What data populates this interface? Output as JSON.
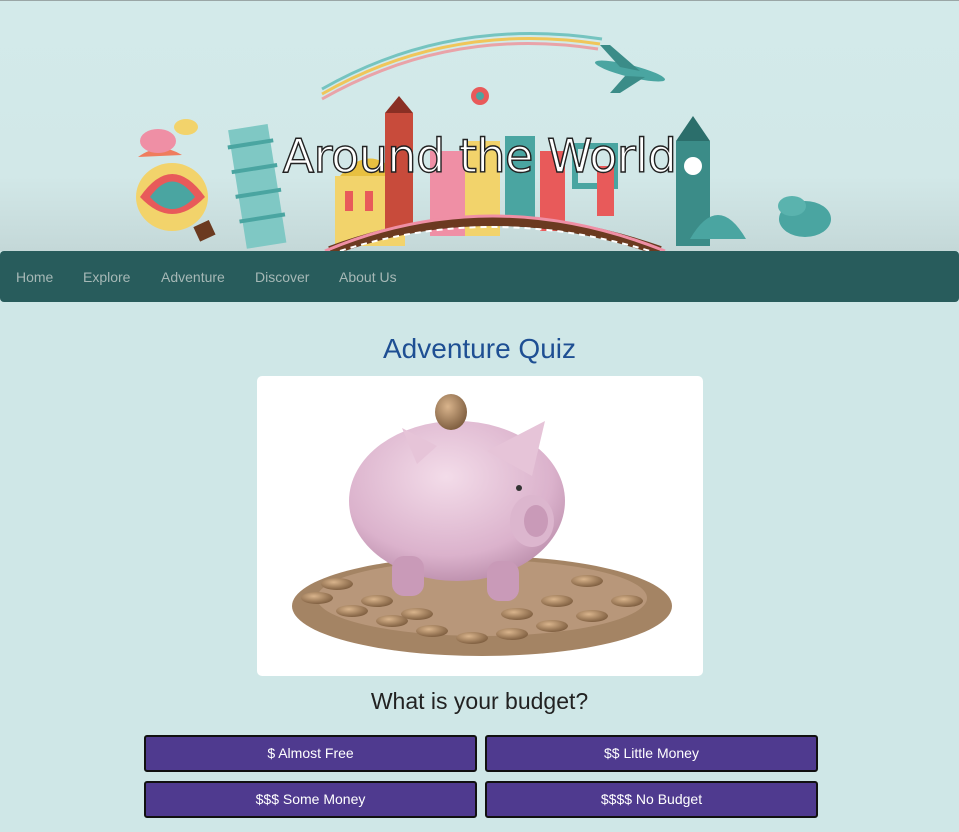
{
  "site": {
    "title": "Around the World"
  },
  "nav": {
    "items": [
      "Home",
      "Explore",
      "Adventure",
      "Discover",
      "About Us"
    ]
  },
  "quiz": {
    "title": "Adventure Quiz",
    "image_icon": "piggy-bank-icon",
    "question": "What is your budget?",
    "options": [
      "$ Almost Free",
      "$$ Little Money",
      "$$$ Some Money",
      "$$$$ No Budget"
    ]
  },
  "colors": {
    "page_bg": "#cfe7e7",
    "nav_bg": "#285c5c",
    "nav_text": "#a6b8b6",
    "quiz_title": "#1e4f93",
    "button_bg": "#4f3a8f"
  }
}
